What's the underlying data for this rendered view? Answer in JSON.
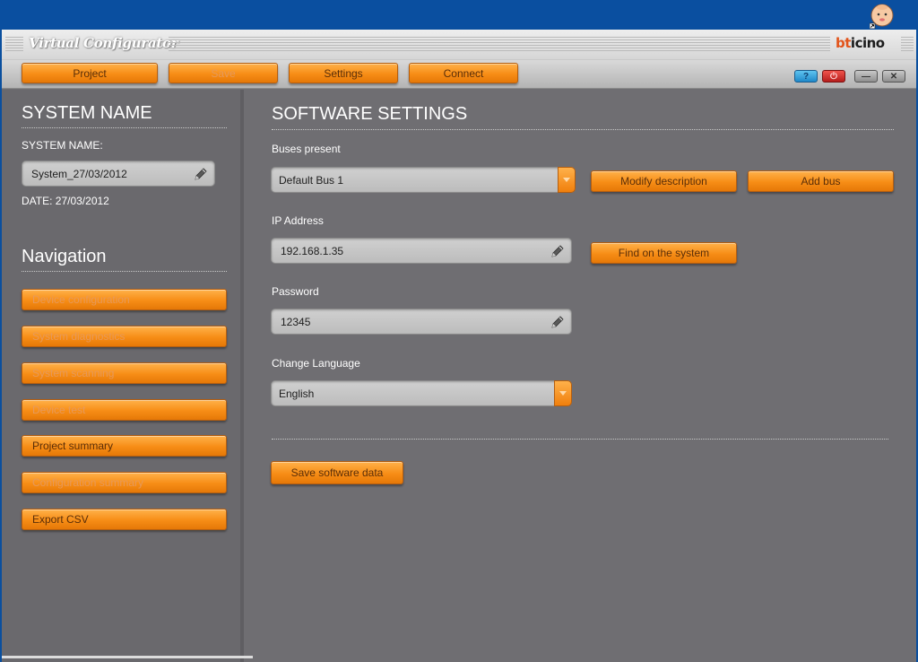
{
  "app": {
    "title": "Virtual Configurator",
    "brand_a": "bt",
    "brand_b": "icino"
  },
  "toolbar": {
    "items": [
      {
        "label": "Project",
        "enabled": true
      },
      {
        "label": "Save",
        "enabled": false
      },
      {
        "label": "Settings",
        "enabled": true
      },
      {
        "label": "Connect",
        "enabled": true
      }
    ],
    "help_label": "?",
    "power_label": "⏻",
    "min_label": "—",
    "close_label": "✕"
  },
  "sidebar": {
    "system_heading": "SYSTEM NAME",
    "system_name_label": "SYSTEM NAME:",
    "system_name_value": "System_27/03/2012",
    "date_text": "DATE: 27/03/2012",
    "nav_heading": "Navigation",
    "nav_items": [
      {
        "label": "Device configuration",
        "enabled": false
      },
      {
        "label": "System diagnostics",
        "enabled": false
      },
      {
        "label": "System scanning",
        "enabled": false
      },
      {
        "label": "Device test",
        "enabled": false
      },
      {
        "label": "Project summary",
        "enabled": true
      },
      {
        "label": "Configuration summary",
        "enabled": false
      },
      {
        "label": "Export CSV",
        "enabled": true
      }
    ]
  },
  "main": {
    "heading": "SOFTWARE SETTINGS",
    "buses_label": "Buses present",
    "bus_selected": "Default Bus 1",
    "modify_button": "Modify description",
    "add_bus_button": "Add bus",
    "ip_label": "IP Address",
    "ip_value": "192.168.1.35",
    "find_button": "Find on the system",
    "password_label": "Password",
    "password_value": "12345",
    "language_label": "Change Language",
    "language_selected": "English",
    "save_button": "Save software data"
  },
  "colors": {
    "accent": "#f78d16",
    "panel": "#6f6e72",
    "desktop": "#0a4fa0"
  }
}
